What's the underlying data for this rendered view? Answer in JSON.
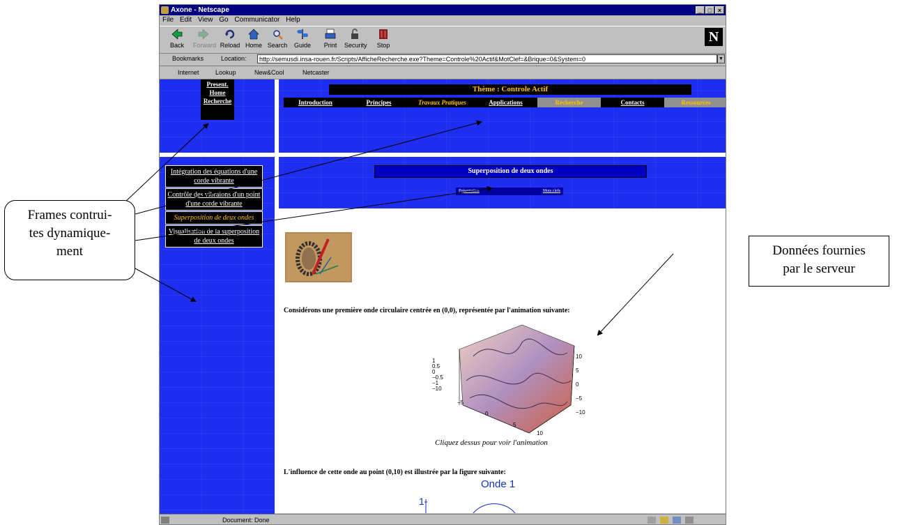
{
  "window": {
    "title": "Axone - Netscape",
    "controls": [
      "_",
      "□",
      "×"
    ],
    "menu": [
      "File",
      "Edit",
      "View",
      "Go",
      "Communicator",
      "Help"
    ]
  },
  "toolbar": {
    "buttons": [
      "Back",
      "Forward",
      "Reload",
      "Home",
      "Search",
      "Guide",
      "Print",
      "Security",
      "Stop"
    ],
    "logo": "N"
  },
  "location": {
    "bookmarks_label": "Bookmarks",
    "location_label": "Location:",
    "url": "http://semusdi.insa-rouen.fr/Scripts/AfficheRecherche.exe?Theme=Controle%20Actif&MotClef=&Brique=0&System=0"
  },
  "personal_toolbar": [
    "Internet",
    "Lookup",
    "New&Cool",
    "Netcaster"
  ],
  "top_left_nav": [
    "Present.",
    "Home",
    "Recherche"
  ],
  "theme_title": "Thème : Controle Actif",
  "theme_tabs": [
    "Introduction",
    "Principes",
    "Travaux Pratiques",
    "Applications",
    "Recherche",
    "Contacts",
    "Ressources"
  ],
  "left_nav": [
    "Intégration des équations d'une corde vibrante",
    "Contrôle des vibraions d'un point d'une corde vibrante",
    "Superposition de deux ondes",
    "Visualisation de la superposition de deux ondes"
  ],
  "section_title": "Superposition de deux ondes",
  "sub_nav": [
    "Présentation",
    "Mots clefs"
  ],
  "content": {
    "paragraph1": "Considérons une première onde circulaire centrée en (0,0), représentée par l'animation suivante:",
    "caption": "Cliquez dessus pour voir l'animation",
    "paragraph2": "L'influence de cette onde au point (0,10) est illustrée par la figure suivante:",
    "onde_title": "Onde 1",
    "onde_ytick": "1",
    "plot_zticks": [
      "1",
      "0.5",
      "0",
      "−0.5",
      "−1",
      "−10"
    ],
    "plot_xticks": [
      "−5",
      "0",
      "5",
      "10"
    ],
    "plot_yticks": [
      "10",
      "5",
      "0",
      "−5",
      "−10"
    ]
  },
  "statusbar": {
    "text": "Document: Done"
  },
  "callouts": {
    "left": [
      "Frames contrui-",
      "tes dynamique-",
      "ment"
    ],
    "right": [
      "Données fournies",
      "par le serveur"
    ]
  }
}
